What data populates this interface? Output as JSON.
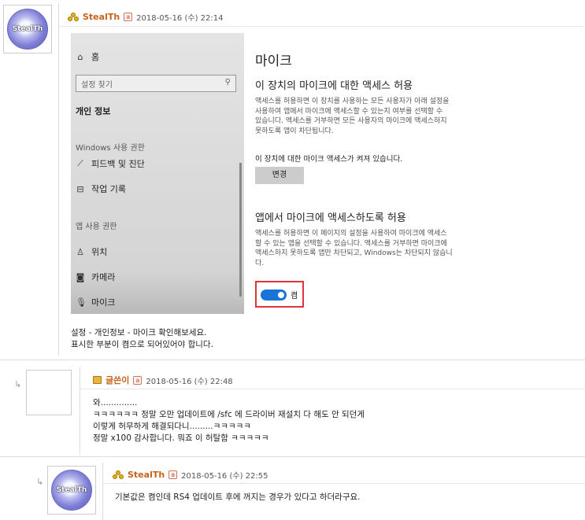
{
  "colors": {
    "accent": "#1a73d6",
    "highlight_border": "#e0343a",
    "nick_orange": "#c7621b"
  },
  "post1": {
    "avatar_text": "StealTh",
    "nick": "StealTh",
    "level": "a",
    "time": "2018-05-16 (수) 22:14",
    "settings_shot": {
      "sidebar": {
        "home": "홈",
        "search_placeholder": "설정 찾기",
        "category": "개인 정보",
        "group_windows": "Windows 사용 권한",
        "feedback": "피드백 및 진단",
        "history": "작업 기록",
        "group_app": "앱 사용 권한",
        "location": "위치",
        "camera": "카메라",
        "mic": "마이크"
      },
      "pane": {
        "title": "마이크",
        "heading1": "이 장치의 마이크에 대한 액세스 허용",
        "desc1": "액세스를 허용하면 이 장치를 사용하는 모든 사용자가 아래 설정을\n사용하여 앱에서 마이크에 액세스할 수 있는지 여부를 선택할 수\n있습니다. 액세스를 거부하면 모든 사용자의 마이크에 액세스하지\n못하도록 앱이 차단됩니다.",
        "status1": "이 장치에 대한 마이크 액세스가 켜져 있습니다.",
        "change_btn": "변경",
        "heading2": "앱에서 마이크에 액세스하도록 허용",
        "desc2": "액세스를 허용하면 이 페이지의 설정을 사용하여 마이크에 액세스\n할 수 있는 앱을 선택할 수 있습니다. 액세스를 거부하면 마이크에\n액세스하지 못하도록 앱만 차단되고, Windows는 차단되지 않습니\n다.",
        "toggle_label": "켬"
      }
    },
    "body": "설정 - 개인정보 - 마이크 확인해보세요.\n표시한 부분이 켬으로 되어있어야 합니다."
  },
  "reply1": {
    "nick": "글쓴이",
    "level": "a",
    "time": "2018-05-16 (수) 22:48",
    "body": "와..............\nㅋㅋㅋㅋㅋㅋ 정말 오만 업데이트에 /sfc 에 드라이버 재설치 다 해도 안 되던게\n이렇게 허무하게 해결되다니.........ㅋㅋㅋㅋㅋ\n정말 x100 감사합니다. 뭐죠 이 허탈함 ㅋㅋㅋㅋㅋ"
  },
  "reply2": {
    "avatar_text": "StealTh",
    "nick": "StealTh",
    "level": "a",
    "time": "2018-05-16 (수) 22:55",
    "body": "기본값은 켬인데 RS4 업데이트 후에 꺼지는 경우가 있다고 하더라구요."
  },
  "reply_arrow": "↳"
}
